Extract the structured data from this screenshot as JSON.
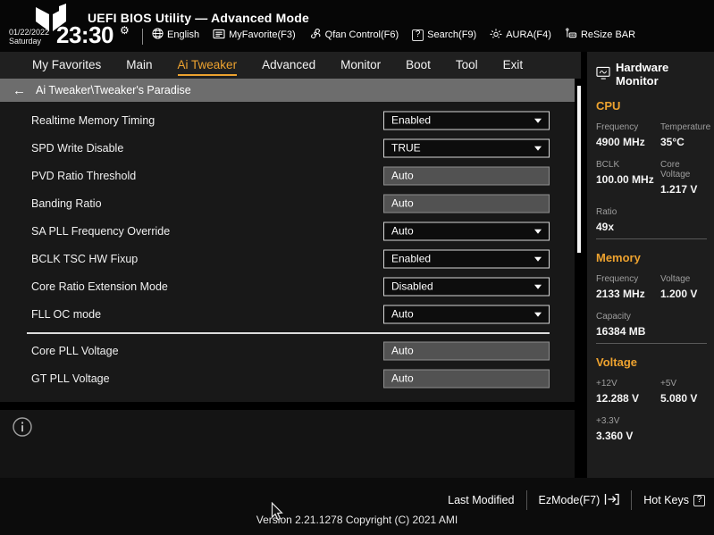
{
  "colors": {
    "accent": "#eda22f",
    "breadcrumb_bg": "#6d6d6d",
    "input_bg": "#525252",
    "dropdown_bg": "#0d0d0d"
  },
  "header": {
    "title": "UEFI BIOS Utility — Advanced Mode",
    "date": "01/22/2022",
    "day": "Saturday",
    "time": "23:30",
    "toolbar": [
      {
        "icon": "globe-icon",
        "label": "English"
      },
      {
        "icon": "myfavorite-icon",
        "label": "MyFavorite(F3)"
      },
      {
        "icon": "qfan-icon",
        "label": "Qfan Control(F6)"
      },
      {
        "icon": "question-box-icon",
        "label": "Search(F9)"
      },
      {
        "icon": "aura-icon",
        "label": "AURA(F4)"
      },
      {
        "icon": "resize-bar-icon",
        "label": "ReSize BAR"
      }
    ]
  },
  "nav": {
    "tabs": [
      {
        "label": "My Favorites",
        "active": false
      },
      {
        "label": "Main",
        "active": false
      },
      {
        "label": "Ai Tweaker",
        "active": true
      },
      {
        "label": "Advanced",
        "active": false
      },
      {
        "label": "Monitor",
        "active": false
      },
      {
        "label": "Boot",
        "active": false
      },
      {
        "label": "Tool",
        "active": false
      },
      {
        "label": "Exit",
        "active": false
      }
    ]
  },
  "breadcrumb": {
    "path": "Ai Tweaker\\Tweaker's Paradise"
  },
  "settings": [
    {
      "label": "Realtime Memory Timing",
      "value": "Enabled",
      "type": "dropdown"
    },
    {
      "label": "SPD Write Disable",
      "value": "TRUE",
      "type": "dropdown"
    },
    {
      "label": "PVD Ratio Threshold",
      "value": "Auto",
      "type": "input"
    },
    {
      "label": "Banding Ratio",
      "value": "Auto",
      "type": "input"
    },
    {
      "label": "SA PLL Frequency Override",
      "value": "Auto",
      "type": "dropdown"
    },
    {
      "label": "BCLK TSC HW Fixup",
      "value": "Enabled",
      "type": "dropdown"
    },
    {
      "label": "Core Ratio Extension Mode",
      "value": "Disabled",
      "type": "dropdown"
    },
    {
      "label": "FLL OC mode",
      "value": "Auto",
      "type": "dropdown"
    },
    {
      "label": "Core PLL Voltage",
      "value": "Auto",
      "type": "input",
      "group_break": true
    },
    {
      "label": "GT PLL Voltage",
      "value": "Auto",
      "type": "input"
    }
  ],
  "hardware_monitor": {
    "title": "Hardware Monitor",
    "sections": [
      {
        "name": "CPU",
        "pairs": [
          {
            "label": "Frequency",
            "value": "4900 MHz"
          },
          {
            "label": "Temperature",
            "value": "35°C"
          },
          {
            "label": "BCLK",
            "value": "100.00 MHz"
          },
          {
            "label": "Core Voltage",
            "value": "1.217 V"
          },
          {
            "label": "Ratio",
            "value": "49x"
          }
        ]
      },
      {
        "name": "Memory",
        "pairs": [
          {
            "label": "Frequency",
            "value": "2133 MHz"
          },
          {
            "label": "Voltage",
            "value": "1.200 V"
          },
          {
            "label": "Capacity",
            "value": "16384 MB"
          }
        ]
      },
      {
        "name": "Voltage",
        "pairs": [
          {
            "label": "+12V",
            "value": "12.288 V"
          },
          {
            "label": "+5V",
            "value": "5.080 V"
          },
          {
            "label": "+3.3V",
            "value": "3.360 V"
          }
        ]
      }
    ]
  },
  "footer": {
    "last_modified": "Last Modified",
    "ezmode": "EzMode(F7)",
    "hot_keys": "Hot Keys",
    "version": "Version 2.21.1278 Copyright (C) 2021 AMI"
  }
}
